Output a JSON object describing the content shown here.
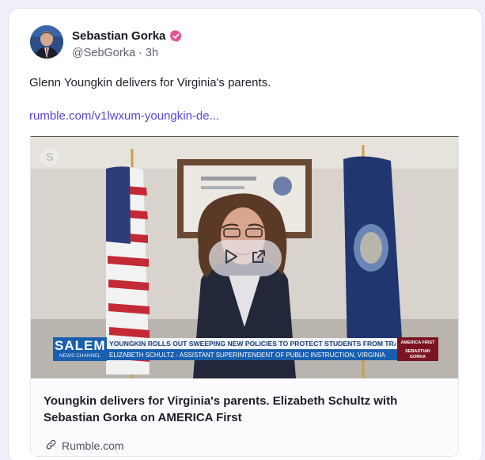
{
  "post": {
    "author_name": "Sebastian Gorka",
    "handle": "@SebGorka",
    "separator": "·",
    "time": "3h",
    "text": "Glenn Youngkin delivers for Virginia's parents.",
    "link_text": "rumble.com/v1lwxum-youngkin-de..."
  },
  "card": {
    "title": "Youngkin delivers for Virginia's parents. Elizabeth Schultz with Sebastian Gorka on AMERICA First",
    "source": "Rumble.com",
    "chyron": {
      "brand_top": "SALEM",
      "brand_bottom": "NEWS CHANNEL",
      "headline": "YOUNGKIN ROLLS OUT SWEEPING NEW POLICIES TO PROTECT STUDENTS FROM TRANSGENDERISM",
      "subline": "ELIZABETH SCHULTZ - ASSISTANT SUPERINTENDENT OF PUBLIC INSTRUCTION, VIRGINIA",
      "show_logo_top": "AMERICA FIRST",
      "show_logo_bottom": "SEBASTIAN GORKA"
    }
  },
  "icons": {
    "verified": "verified-badge-icon",
    "play": "play-icon",
    "open_external": "open-external-icon",
    "link": "link-icon",
    "skype": "skype-icon"
  },
  "colors": {
    "accent": "#5747d6",
    "verified": "#e0558f",
    "chyron_blue": "#1a5fae",
    "chyron_red": "#c8202c"
  }
}
